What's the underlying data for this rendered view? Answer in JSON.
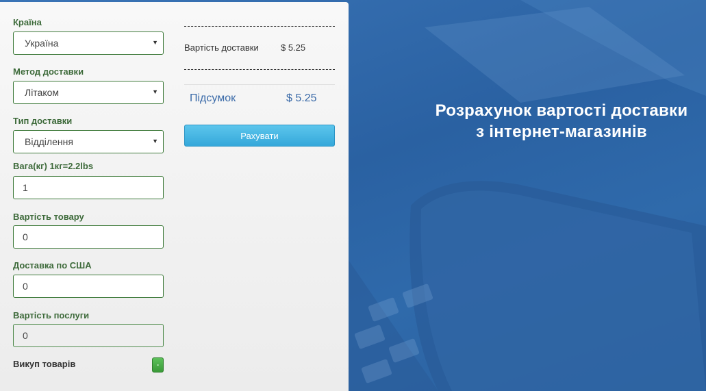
{
  "form": {
    "country": {
      "label": "Країна",
      "value": "Україна"
    },
    "method": {
      "label": "Метод доставки",
      "value": "Літаком"
    },
    "type": {
      "label": "Тип доставки",
      "value": "Відділення"
    },
    "weight": {
      "label": "Вага(кг) 1кг=2.2lbs",
      "value": "1"
    },
    "goods_cost": {
      "label": "Вартість товару",
      "value": "0"
    },
    "usa_delivery": {
      "label": "Доставка по США",
      "value": "0"
    },
    "service_cost": {
      "label": "Вартість послуги",
      "value": "0"
    },
    "buyout": {
      "label": "Викуп товарів",
      "toggle": "-"
    }
  },
  "summary": {
    "delivery_cost_label": "Вартість доставки",
    "delivery_cost_value": "$ 5.25",
    "total_label": "Підсумок",
    "total_value": "$ 5.25",
    "calc_button": "Рахувати"
  },
  "hero": {
    "line1": "Розрахунок вартості доставки",
    "line2": "з інтернет-магазинів"
  },
  "icons": {
    "select_caret": "caret-down-icon"
  },
  "colors": {
    "label_green": "#3d6a3a",
    "border_green": "#3e7a3a",
    "button_blue": "#35a8da",
    "total_blue": "#3a6aa8",
    "background_blue": "#2c63a4"
  }
}
